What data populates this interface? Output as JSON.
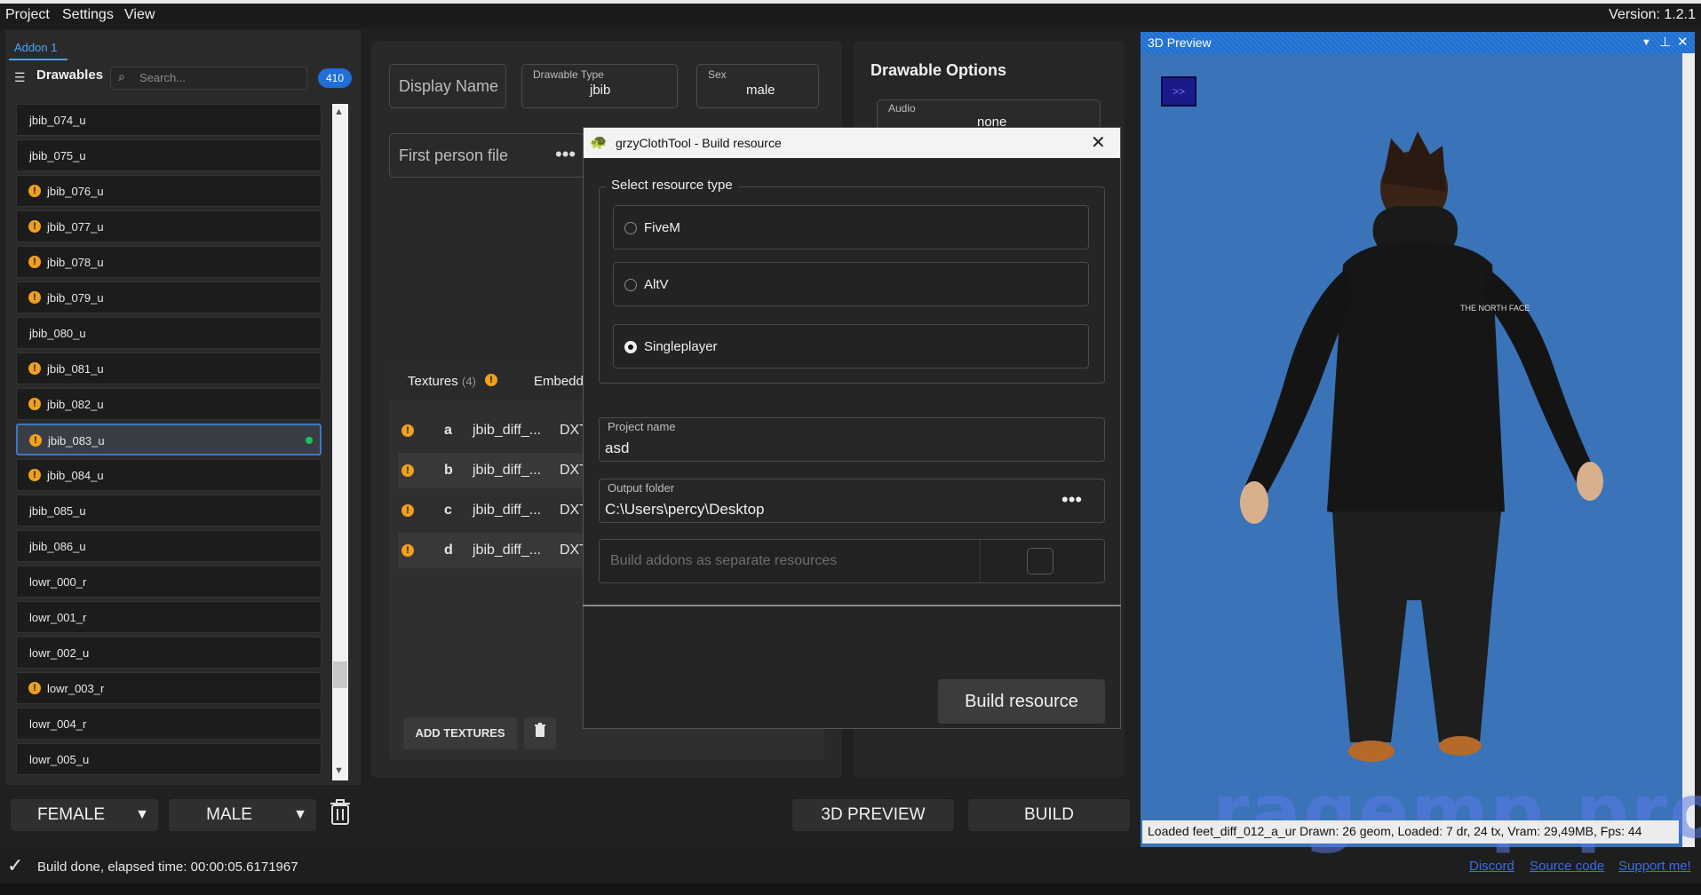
{
  "menu": {
    "project": "Project",
    "settings": "Settings",
    "view": "View",
    "version": "Version: 1.2.1"
  },
  "left": {
    "tab": "Addon 1",
    "drawables_label": "Drawables",
    "search_placeholder": "Search...",
    "count": "410",
    "items": [
      {
        "label": "jbib_074_u",
        "warn": false
      },
      {
        "label": "jbib_075_u",
        "warn": false
      },
      {
        "label": "jbib_076_u",
        "warn": true
      },
      {
        "label": "jbib_077_u",
        "warn": true
      },
      {
        "label": "jbib_078_u",
        "warn": true
      },
      {
        "label": "jbib_079_u",
        "warn": true
      },
      {
        "label": "jbib_080_u",
        "warn": false
      },
      {
        "label": "jbib_081_u",
        "warn": true
      },
      {
        "label": "jbib_082_u",
        "warn": true
      },
      {
        "label": "jbib_083_u",
        "warn": true,
        "selected": true
      },
      {
        "label": "jbib_084_u",
        "warn": true
      },
      {
        "label": "jbib_085_u",
        "warn": false
      },
      {
        "label": "jbib_086_u",
        "warn": false
      },
      {
        "label": "lowr_000_r",
        "warn": false
      },
      {
        "label": "lowr_001_r",
        "warn": false
      },
      {
        "label": "lowr_002_u",
        "warn": false
      },
      {
        "label": "lowr_003_r",
        "warn": true
      },
      {
        "label": "lowr_004_r",
        "warn": false
      },
      {
        "label": "lowr_005_u",
        "warn": false
      }
    ],
    "female_btn": "FEMALE",
    "male_btn": "MALE"
  },
  "mid": {
    "display_name_placeholder": "Display Name",
    "drawable_type_label": "Drawable Type",
    "drawable_type_value": "jbib",
    "sex_label": "Sex",
    "sex_value": "male",
    "first_person_placeholder": "First person file",
    "textures_tab": "Textures",
    "textures_count": "(4)",
    "embedded_tab": "Embedd",
    "textures": [
      {
        "letter": "a",
        "name": "jbib_diff_...",
        "fmt": "DXT"
      },
      {
        "letter": "b",
        "name": "jbib_diff_...",
        "fmt": "DXT"
      },
      {
        "letter": "c",
        "name": "jbib_diff_...",
        "fmt": "DXT"
      },
      {
        "letter": "d",
        "name": "jbib_diff_...",
        "fmt": "DXT"
      }
    ],
    "add_textures": "ADD TEXTURES"
  },
  "options": {
    "title": "Drawable Options",
    "audio_label": "Audio",
    "audio_value": "none"
  },
  "bottom": {
    "preview_btn": "3D PREVIEW",
    "build_btn": "BUILD"
  },
  "status": {
    "text": "Build done, elapsed time: 00:00:05.6171967",
    "discord": "Discord",
    "source": "Source code",
    "support": "Support me!"
  },
  "preview": {
    "title": "3D Preview",
    "toggle": ">>",
    "status": "Loaded feet_diff_012_a_ur    Drawn: 26 geom, Loaded: 7 dr, 24 tx, Vram: 29,49MB, Fps: 44",
    "watermark": "ragemp.pro"
  },
  "dialog": {
    "title": "grzyClothTool - Build resource",
    "group_title": "Select resource type",
    "options": [
      "FiveM",
      "AltV",
      "Singleplayer"
    ],
    "selected": "Singleplayer",
    "project_name_label": "Project name",
    "project_name_value": "asd",
    "output_folder_label": "Output folder",
    "output_folder_value": "C:\\Users\\percy\\Desktop",
    "separate_label": "Build addons as separate resources",
    "build_btn": "Build resource"
  }
}
